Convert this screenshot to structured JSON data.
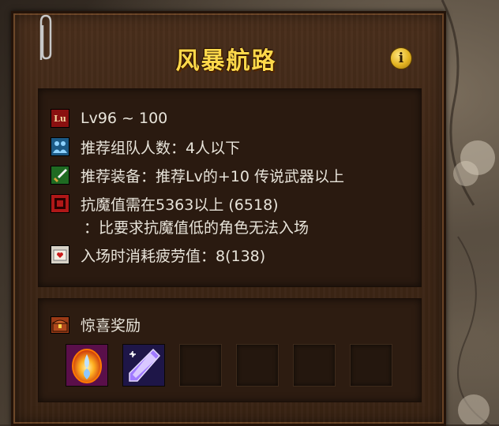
{
  "dungeon": {
    "title": "风暴航路",
    "info_icon": "info-icon",
    "info_label": "i"
  },
  "requirements": {
    "level": {
      "icon": "level-icon",
      "icon_text": "Lu",
      "text": "Lv96 ~ 100"
    },
    "party": {
      "icon": "party-icon",
      "text": "推荐组队人数：4人以下"
    },
    "gear": {
      "icon": "sword-icon",
      "text": "推荐装备：推荐Lv的+10 传说武器以上"
    },
    "resistance": {
      "icon": "resistance-icon",
      "text": "抗魔值需在5363以上 (6518)",
      "note": "：比要求抗魔值低的角色无法入场"
    },
    "fatigue": {
      "icon": "fatigue-icon",
      "text": "入场时消耗疲劳值：8(138)"
    }
  },
  "rewards": {
    "title": "惊喜奖励",
    "icon": "treasure-chest-icon",
    "items": [
      {
        "name": "flame-orb-item-icon",
        "filled": true
      },
      {
        "name": "crystal-shard-item-icon",
        "filled": true
      },
      {
        "name": "empty-slot",
        "filled": false
      },
      {
        "name": "empty-slot",
        "filled": false
      },
      {
        "name": "empty-slot",
        "filled": false
      },
      {
        "name": "empty-slot",
        "filled": false
      }
    ]
  },
  "colors": {
    "title": "#ffd84a",
    "text": "#e8e4da",
    "panel": "#3d2616"
  }
}
